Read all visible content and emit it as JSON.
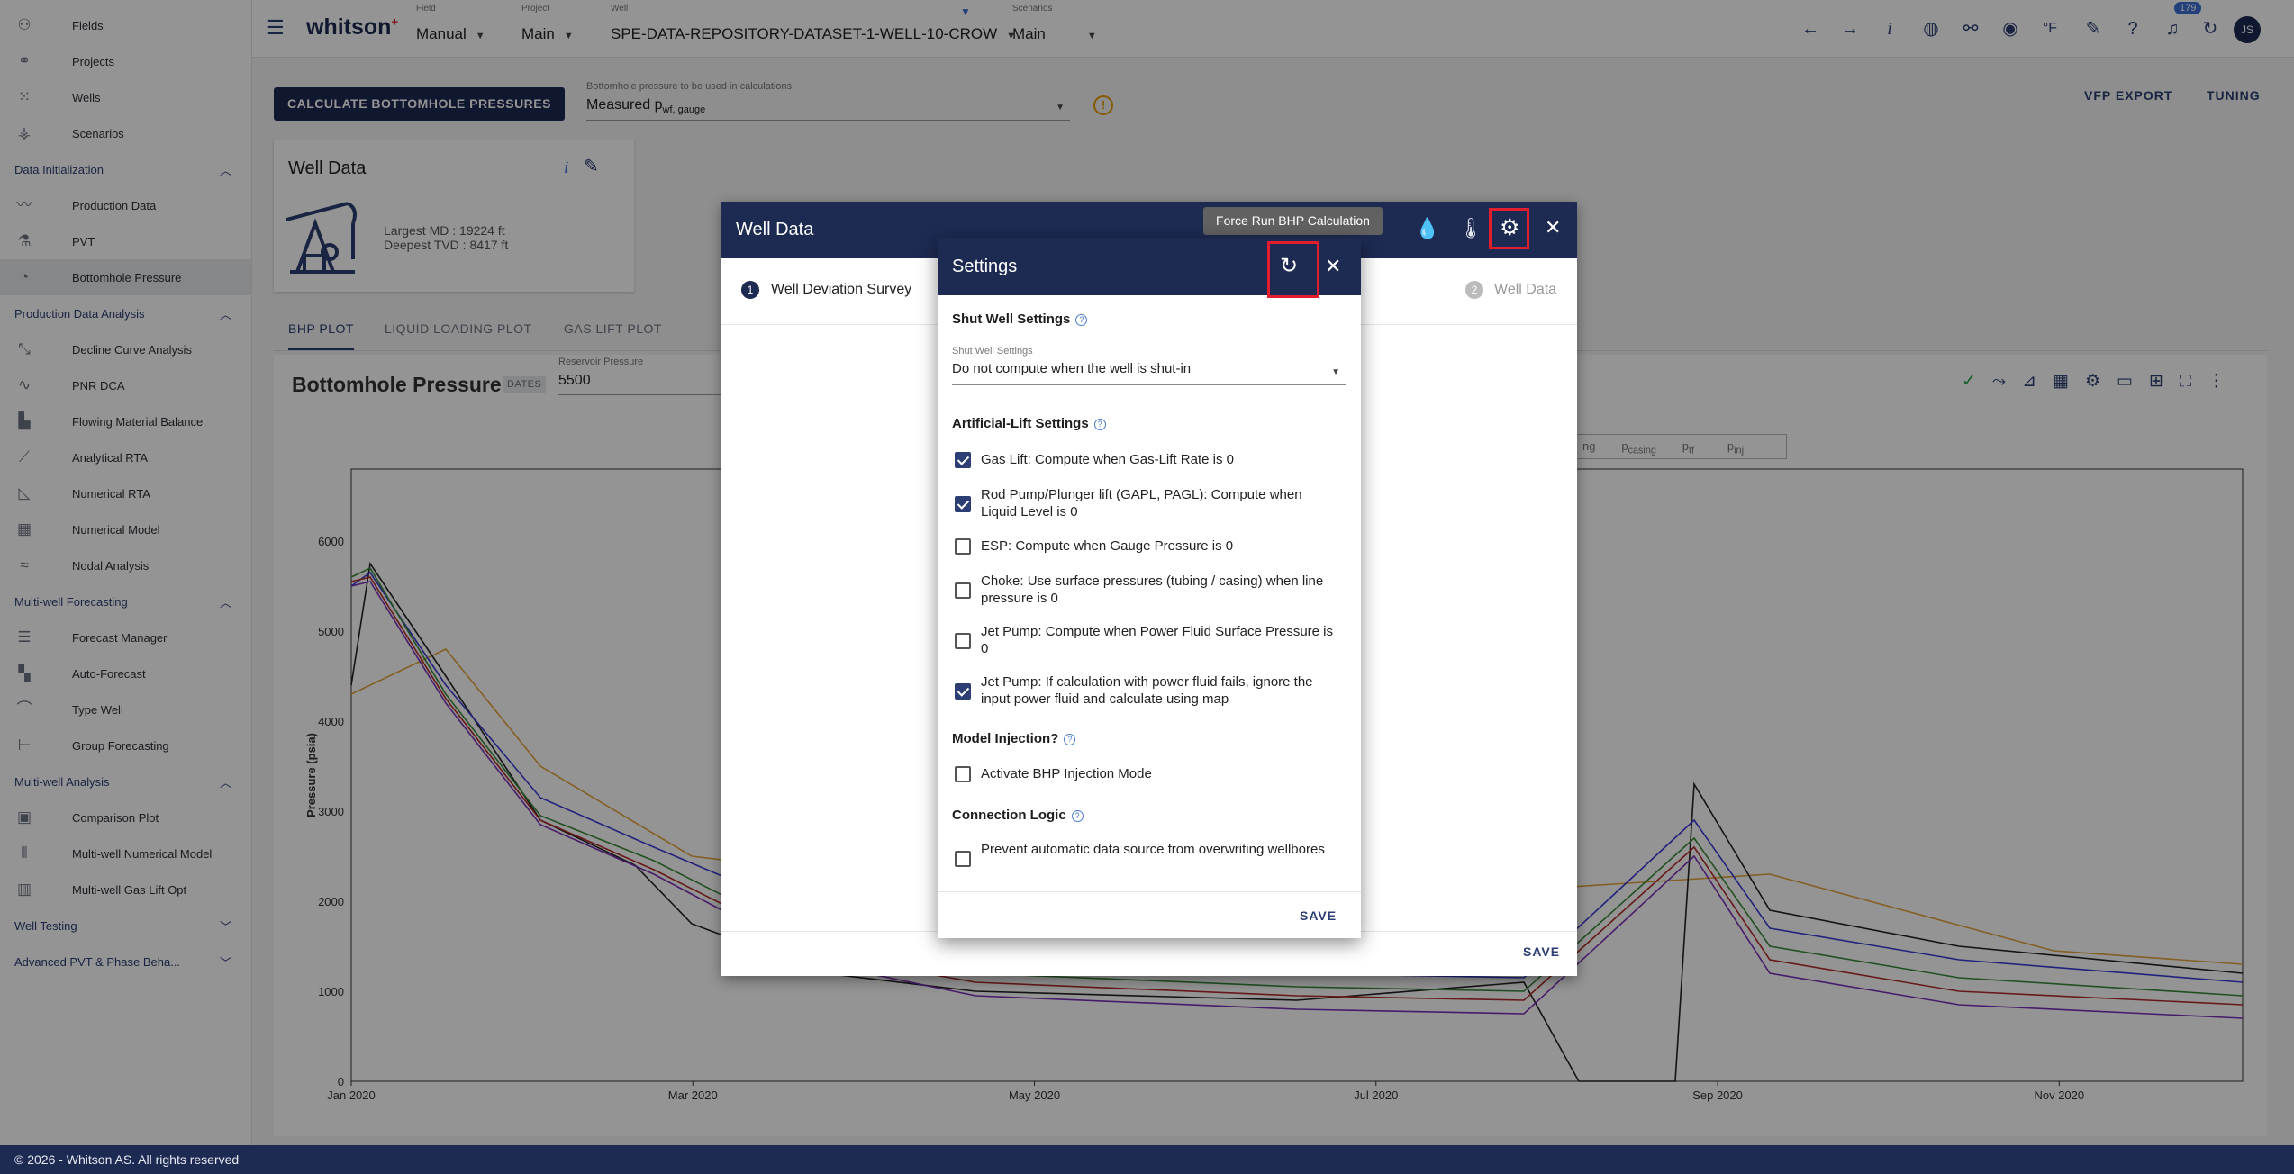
{
  "app": {
    "logo": "whitson",
    "logo_sup": "+",
    "footer": "© 2026 - Whitson AS. All rights reserved"
  },
  "sidebar": {
    "top_items": [
      {
        "label": "Fields",
        "icon": "fields-icon"
      },
      {
        "label": "Projects",
        "icon": "projects-icon"
      },
      {
        "label": "Wells",
        "icon": "wells-icon"
      },
      {
        "label": "Scenarios",
        "icon": "scenarios-icon"
      }
    ],
    "sections": [
      {
        "label": "Data Initialization",
        "items": [
          "Production Data",
          "PVT",
          "Bottomhole Pressure"
        ]
      },
      {
        "label": "Production Data Analysis",
        "items": [
          "Decline Curve Analysis",
          "PNR DCA",
          "Flowing Material Balance",
          "Analytical RTA",
          "Numerical RTA",
          "Numerical Model",
          "Nodal Analysis"
        ]
      },
      {
        "label": "Multi-well Forecasting",
        "items": [
          "Forecast Manager",
          "Auto-Forecast",
          "Type Well",
          "Group Forecasting"
        ]
      },
      {
        "label": "Multi-well Analysis",
        "items": [
          "Comparison Plot",
          "Multi-well Numerical Model",
          "Multi-well Gas Lift Opt"
        ]
      },
      {
        "label": "Well Testing",
        "items": []
      },
      {
        "label": "Advanced PVT & Phase Beha...",
        "items": []
      }
    ],
    "active": "Bottomhole Pressure"
  },
  "topbar": {
    "field_label": "Field",
    "field_value": "Manual",
    "project_label": "Project",
    "project_value": "Main",
    "well_label": "Well",
    "well_value": "SPE-DATA-REPOSITORY-DATASET-1-WELL-10-CROW",
    "scenario_label": "Scenarios",
    "scenario_value": "Main",
    "notification_count": "179",
    "avatar": "JS",
    "temp_unit": "°F"
  },
  "main": {
    "calc_button": "CALCULATE BOTTOMHOLE PRESSURES",
    "bhp_select_label": "Bottomhole pressure to be used in calculations",
    "bhp_select_value": "Measured p",
    "bhp_select_sub": "wf, gauge",
    "vfp_export": "VFP EXPORT",
    "tuning": "TUNING",
    "well_data_card": {
      "title": "Well Data",
      "largest_md": "Largest MD :  19224 ft",
      "deepest_tvd": "Deepest TVD :  8417 ft"
    },
    "tabs": [
      "BHP PLOT",
      "LIQUID LOADING PLOT",
      "GAS LIFT PLOT"
    ],
    "plot_title": "Bottomhole Pressure",
    "dates_badge": "DATES",
    "reservoir_label": "Reservoir Pressure",
    "reservoir_value": "5500"
  },
  "chart_data": {
    "type": "line",
    "ylabel": "Pressure (psia)",
    "ylim": [
      0,
      6800
    ],
    "yticks": [
      0,
      1000,
      2000,
      3000,
      4000,
      5000,
      6000
    ],
    "xticks": [
      "Jan 2020",
      "Mar 2020",
      "May 2020",
      "Jul 2020",
      "Sep 2020",
      "Nov 2020"
    ],
    "legend": [
      "p",
      "casing",
      "p",
      "tf",
      "p",
      "inj"
    ],
    "series": [
      {
        "color": "#e3a33b",
        "points": [
          [
            0,
            4300
          ],
          [
            0.05,
            4800
          ],
          [
            0.1,
            3500
          ],
          [
            0.18,
            2500
          ],
          [
            0.3,
            2200
          ],
          [
            0.45,
            2000
          ],
          [
            0.6,
            2100
          ],
          [
            0.75,
            2300
          ],
          [
            0.9,
            1450
          ],
          [
            1,
            1300
          ]
        ]
      },
      {
        "color": "#222222",
        "points": [
          [
            0,
            4400
          ],
          [
            0.01,
            5750
          ],
          [
            0.05,
            4500
          ],
          [
            0.1,
            2900
          ],
          [
            0.15,
            2400
          ],
          [
            0.18,
            1750
          ],
          [
            0.25,
            1200
          ],
          [
            0.33,
            1000
          ],
          [
            0.5,
            900
          ],
          [
            0.62,
            1100
          ],
          [
            0.649,
            0
          ],
          [
            0.7,
            0
          ],
          [
            0.71,
            3300
          ],
          [
            0.75,
            1900
          ],
          [
            0.85,
            1500
          ],
          [
            1,
            1200
          ]
        ]
      },
      {
        "color": "#3b3bd6",
        "points": [
          [
            0,
            5500
          ],
          [
            0.01,
            5650
          ],
          [
            0.05,
            4400
          ],
          [
            0.1,
            3150
          ],
          [
            0.16,
            2600
          ],
          [
            0.25,
            1800
          ],
          [
            0.33,
            1400
          ],
          [
            0.5,
            1200
          ],
          [
            0.62,
            1150
          ],
          [
            0.71,
            2900
          ],
          [
            0.75,
            1700
          ],
          [
            0.85,
            1350
          ],
          [
            1,
            1100
          ]
        ]
      },
      {
        "color": "#3a8a3a",
        "points": [
          [
            0,
            5600
          ],
          [
            0.01,
            5700
          ],
          [
            0.05,
            4300
          ],
          [
            0.1,
            2950
          ],
          [
            0.16,
            2450
          ],
          [
            0.25,
            1500
          ],
          [
            0.33,
            1200
          ],
          [
            0.5,
            1050
          ],
          [
            0.62,
            1000
          ],
          [
            0.71,
            2700
          ],
          [
            0.75,
            1500
          ],
          [
            0.85,
            1150
          ],
          [
            1,
            950
          ]
        ]
      },
      {
        "color": "#b22a2a",
        "points": [
          [
            0,
            5550
          ],
          [
            0.01,
            5600
          ],
          [
            0.05,
            4250
          ],
          [
            0.1,
            2900
          ],
          [
            0.16,
            2350
          ],
          [
            0.25,
            1400
          ],
          [
            0.33,
            1100
          ],
          [
            0.5,
            950
          ],
          [
            0.62,
            900
          ],
          [
            0.71,
            2600
          ],
          [
            0.75,
            1350
          ],
          [
            0.85,
            1000
          ],
          [
            1,
            850
          ]
        ]
      },
      {
        "color": "#7a2fb8",
        "points": [
          [
            0,
            5500
          ],
          [
            0.01,
            5550
          ],
          [
            0.05,
            4200
          ],
          [
            0.1,
            2850
          ],
          [
            0.16,
            2300
          ],
          [
            0.25,
            1300
          ],
          [
            0.33,
            950
          ],
          [
            0.5,
            800
          ],
          [
            0.62,
            750
          ],
          [
            0.71,
            2500
          ],
          [
            0.75,
            1200
          ],
          [
            0.85,
            850
          ],
          [
            1,
            700
          ]
        ]
      }
    ]
  },
  "well_data_dialog": {
    "title": "Well Data",
    "step1": "Well Deviation Survey",
    "step1_num": "1",
    "step2": "Well Data",
    "step2_num": "2",
    "save": "SAVE",
    "tooltip": "Force Run BHP Calculation"
  },
  "settings": {
    "title": "Settings",
    "shut_header": "Shut Well Settings",
    "shut_label": "Shut Well Settings",
    "shut_value": "Do not compute when the well is shut-in",
    "al_header": "Artificial-Lift Settings",
    "options": [
      {
        "label": "Gas Lift: Compute when Gas-Lift Rate is 0",
        "checked": true
      },
      {
        "label": "Rod Pump/Plunger lift (GAPL, PAGL): Compute when Liquid Level is 0",
        "checked": true
      },
      {
        "label": "ESP: Compute when Gauge Pressure is 0",
        "checked": false
      },
      {
        "label": "Choke: Use surface pressures (tubing / casing) when line pressure is 0",
        "checked": false
      },
      {
        "label": "Jet Pump: Compute when Power Fluid Surface Pressure is 0",
        "checked": false
      },
      {
        "label": "Jet Pump: If calculation with power fluid fails, ignore the input power fluid and calculate using map",
        "checked": true
      }
    ],
    "inj_header": "Model Injection?",
    "inj_option": "Activate BHP Injection Mode",
    "conn_header": "Connection Logic",
    "conn_option": "Prevent automatic data source from overwriting wellbores",
    "save": "SAVE"
  },
  "colors": {
    "primary": "#1d2a52",
    "accent": "#2c3e73",
    "highlight": "#e11d2e",
    "warning": "#e69b00"
  }
}
